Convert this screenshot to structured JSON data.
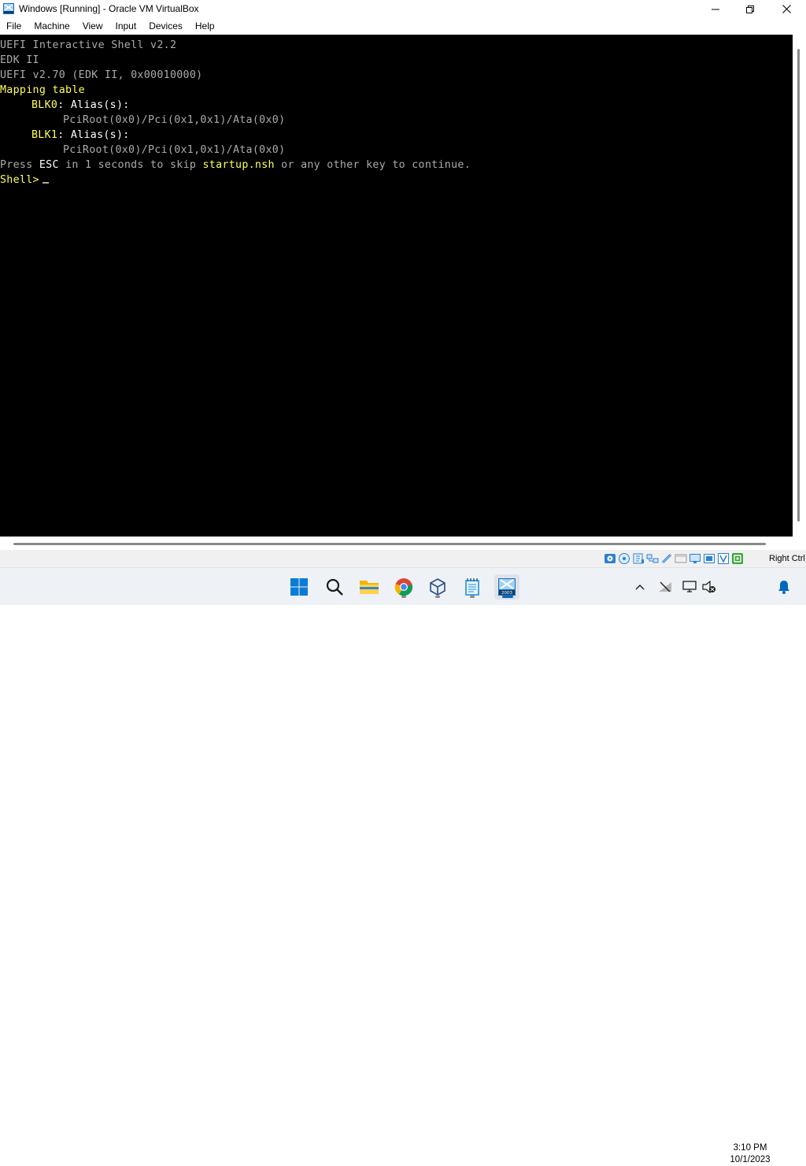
{
  "window": {
    "title": "Windows [Running] - Oracle VM VirtualBox"
  },
  "menu": [
    "File",
    "Machine",
    "View",
    "Input",
    "Devices",
    "Help"
  ],
  "console": {
    "line1": "UEFI Interactive Shell v2.2",
    "line2": "EDK II",
    "line3": "UEFI v2.70 (EDK II, 0x00010000)",
    "line4": "Mapping table",
    "blk0_name": "BLK0",
    "blk0_alias": ": Alias(s):",
    "blk0_path": "PciRoot(0x0)/Pci(0x1,0x1)/Ata(0x0)",
    "blk1_name": "BLK1",
    "blk1_alias": ": Alias(s):",
    "blk1_path": "PciRoot(0x0)/Pci(0x1,0x1)/Ata(0x0)",
    "press_a": "Press ",
    "press_esc": "ESC",
    "press_b": " in 1 seconds to skip ",
    "press_nsh": "startup.nsh",
    "press_c": " or any other key to continue.",
    "prompt": "Shell>"
  },
  "statusbar": {
    "host_key": "Right Ctrl",
    "icons": [
      "hard-disk-icon",
      "optical-drive-icon",
      "audio-icon",
      "network-icon",
      "usb-icon",
      "shared-folders-icon",
      "display-icon",
      "recording-icon",
      "cpu-icon",
      "mouse-integration-icon"
    ]
  },
  "taskbar": {
    "apps": [
      "start-icon",
      "search-icon",
      "file-explorer-icon",
      "chrome-icon",
      "virtualbox-icon",
      "notepad-icon",
      "windows-2003-vm-icon"
    ],
    "active_app_label": "2003",
    "time": "3:10 PM",
    "date": "10/1/2023"
  },
  "colors": {
    "console_bg": "#000000",
    "console_text": "#aaaaaa",
    "console_highlight": "#ffff55",
    "taskbar_bg": "#eef1f5",
    "accent": "#0067c0"
  }
}
